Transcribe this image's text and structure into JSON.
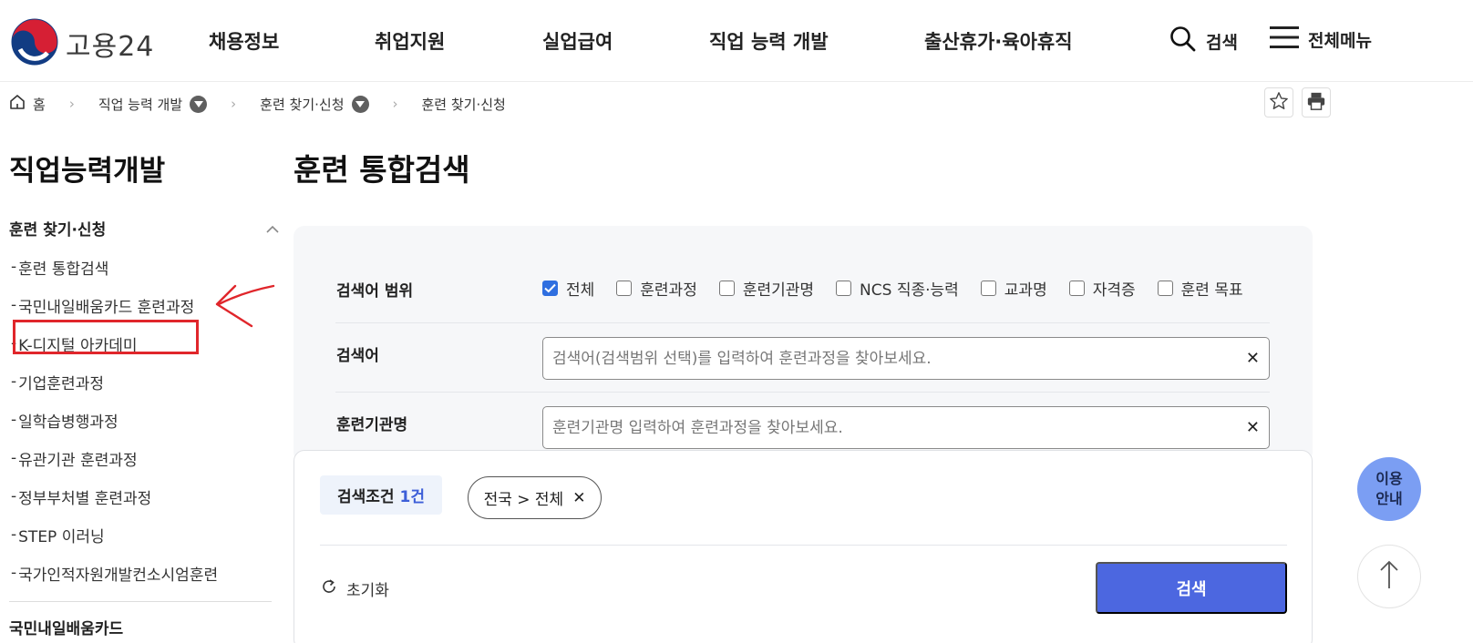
{
  "header": {
    "logo_text": "고용24",
    "nav": [
      "채용정보",
      "취업지원",
      "실업급여",
      "직업 능력 개발",
      "출산휴가·육아휴직"
    ],
    "search_label": "검색",
    "menu_label": "전체메뉴"
  },
  "breadcrumb": {
    "home": "홈",
    "level1": "직업 능력 개발",
    "level2": "훈련 찾기·신청",
    "current": "훈련 찾기·신청"
  },
  "sidebar": {
    "title": "직업능력개발",
    "group": "훈련 찾기·신청",
    "items": [
      {
        "label": "훈련 통합검색"
      },
      {
        "label": "국민내일배움카드 훈련과정"
      },
      {
        "label": "K-디지털 아카데미"
      },
      {
        "label": "기업훈련과정"
      },
      {
        "label": "일학습병행과정"
      },
      {
        "label": "유관기관 훈련과정"
      },
      {
        "label": "정부부처별 훈련과정"
      },
      {
        "label": "STEP 이러닝"
      },
      {
        "label": "국가인적자원개발컨소시엄훈련"
      }
    ],
    "next_group": "국민내일배움카드"
  },
  "main": {
    "title": "훈련 통합검색",
    "scope_label": "검색어 범위",
    "scope_options": [
      {
        "label": "전체",
        "checked": true
      },
      {
        "label": "훈련과정",
        "checked": false
      },
      {
        "label": "훈련기관명",
        "checked": false
      },
      {
        "label": "NCS 직종·능력",
        "checked": false
      },
      {
        "label": "교과명",
        "checked": false
      },
      {
        "label": "자격증",
        "checked": false
      },
      {
        "label": "훈련 목표",
        "checked": false
      }
    ],
    "keyword_label": "검색어",
    "keyword_placeholder": "검색어(검색범위 선택)를 입력하여 훈련과정을 찾아보세요.",
    "keyword_value": "",
    "institution_label": "훈련기관명",
    "institution_placeholder": "훈련기관명 입력하여 훈련과정을 찾아보세요.",
    "institution_value": "",
    "condition_label": "검색조건",
    "condition_count": "1건",
    "filter_tag": "전국 > 전체",
    "reset_label": "초기화",
    "search_button": "검색"
  },
  "floating": {
    "guide_line1": "이용",
    "guide_line2": "안내"
  },
  "colors": {
    "primary_button": "#4c67e0",
    "checkbox_checked": "#2f6fe0",
    "guide_fab": "#7b9ef3",
    "annotation": "#e0262b"
  },
  "icons": [
    "search-icon",
    "hamburger-icon",
    "home-icon",
    "chevron-right-icon",
    "dropdown-icon",
    "star-icon",
    "print-icon",
    "chevron-up-icon",
    "close-icon",
    "refresh-icon",
    "arrow-up-icon"
  ]
}
